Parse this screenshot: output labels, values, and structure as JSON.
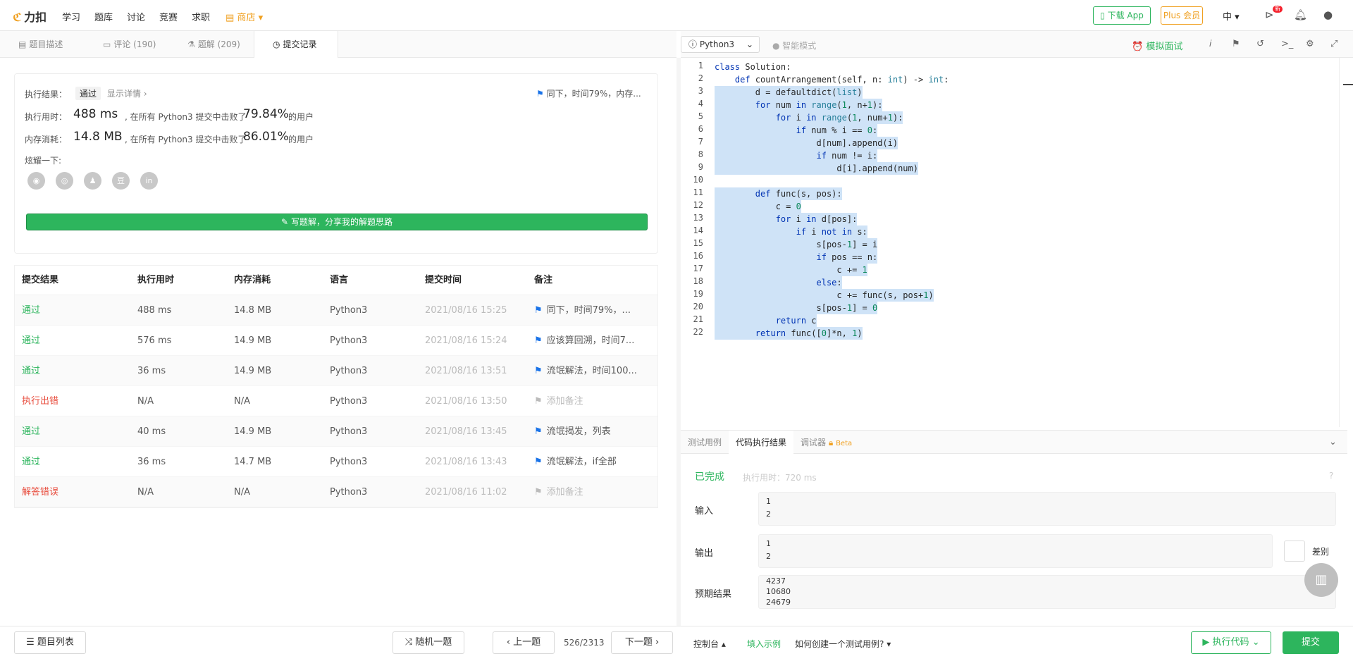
{
  "nav": {
    "logo": "力扣",
    "items": [
      "学习",
      "题库",
      "讨论",
      "竞赛",
      "求职"
    ],
    "shop": "商店",
    "download_app": "下载 App",
    "plus": "Plus 会员",
    "lang": "中",
    "badge": "新"
  },
  "left_tabs": [
    {
      "label": "题目描述"
    },
    {
      "label": "评论 (190)"
    },
    {
      "label": "题解 (209)"
    },
    {
      "label": "提交记录"
    }
  ],
  "toolbar": {
    "language": "Python3",
    "smart_mode": "智能模式",
    "mock_interview": "模拟面试"
  },
  "result": {
    "label_result": "执行结果：",
    "status": "通过",
    "show_detail": "显示详情 ›",
    "note": "同下，时间79%，内存...",
    "label_time": "执行用时：",
    "time": "488 ms",
    "label_mem": "内存消耗：",
    "mem": "14.8 MB",
    "beat_prefix": ", 在所有 Python3 提交中击败了",
    "time_pct": "79.84%",
    "mem_pct": "86.01%",
    "suffix": "的用户",
    "share_label": "炫耀一下:",
    "share_icons": [
      "wechat-icon",
      "weibo-icon",
      "qq-icon",
      "douban-icon",
      "linkedin-icon"
    ],
    "write_solution": "写题解，分享我的解题思路"
  },
  "table": {
    "headers": [
      "提交结果",
      "执行用时",
      "内存消耗",
      "语言",
      "提交时间",
      "备注"
    ],
    "rows": [
      {
        "status": "通过",
        "ok": true,
        "time": "488 ms",
        "mem": "14.8 MB",
        "lang": "Python3",
        "date": "2021/08/16 15:25",
        "note": "同下，时间79%，...",
        "has_note": true
      },
      {
        "status": "通过",
        "ok": true,
        "time": "576 ms",
        "mem": "14.9 MB",
        "lang": "Python3",
        "date": "2021/08/16 15:24",
        "note": "应该算回溯，时间7...",
        "has_note": true
      },
      {
        "status": "通过",
        "ok": true,
        "time": "36 ms",
        "mem": "14.9 MB",
        "lang": "Python3",
        "date": "2021/08/16 13:51",
        "note": "流氓解法，时间100...",
        "has_note": true
      },
      {
        "status": "执行出错",
        "ok": false,
        "time": "N/A",
        "mem": "N/A",
        "lang": "Python3",
        "date": "2021/08/16 13:50",
        "note": "添加备注",
        "has_note": false
      },
      {
        "status": "通过",
        "ok": true,
        "time": "40 ms",
        "mem": "14.9 MB",
        "lang": "Python3",
        "date": "2021/08/16 13:45",
        "note": "流氓揭发，列表",
        "has_note": true
      },
      {
        "status": "通过",
        "ok": true,
        "time": "36 ms",
        "mem": "14.7 MB",
        "lang": "Python3",
        "date": "2021/08/16 13:43",
        "note": "流氓解法，if全部",
        "has_note": true
      },
      {
        "status": "解答错误",
        "ok": false,
        "time": "N/A",
        "mem": "N/A",
        "lang": "Python3",
        "date": "2021/08/16 11:02",
        "note": "添加备注",
        "has_note": false
      }
    ]
  },
  "code": [
    "class Solution:",
    "    def countArrangement(self, n: int) -> int:",
    "        d = defaultdict(list)",
    "        for num in range(1, n+1):",
    "            for i in range(1, num+1):",
    "                if num % i == 0:",
    "                    d[num].append(i)",
    "                    if num != i:",
    "                        d[i].append(num)",
    "",
    "        def func(s, pos):",
    "            c = 0",
    "            for i in d[pos]:",
    "                if i not in s:",
    "                    s[pos-1] = i",
    "                    if pos == n:",
    "                        c += 1",
    "                    else:",
    "                        c += func(s, pos+1)",
    "                    s[pos-1] = 0",
    "            return c",
    "        return func([0]*n, 1)"
  ],
  "console": {
    "tabs": [
      "测试用例",
      "代码执行结果",
      "调试器"
    ],
    "beta": "Beta",
    "status": "已完成",
    "elapsed": "执行用时：720 ms",
    "input_label": "输入",
    "input_lines": [
      "1",
      "2"
    ],
    "output_label": "输出",
    "output_lines": [
      "1",
      "2"
    ],
    "diff_label": "差别",
    "expected_label": "预期结果",
    "expected_lines": [
      "4237",
      "10680",
      "24679"
    ]
  },
  "bottom": {
    "problem_list": "题目列表",
    "random": "随机一题",
    "prev": "上一题",
    "pager": "526/2313",
    "next": "下一题",
    "console": "控制台",
    "fill_example": "填入示例",
    "how_create": "如何创建一个测试用例?",
    "run_code": "执行代码",
    "submit": "提交"
  }
}
